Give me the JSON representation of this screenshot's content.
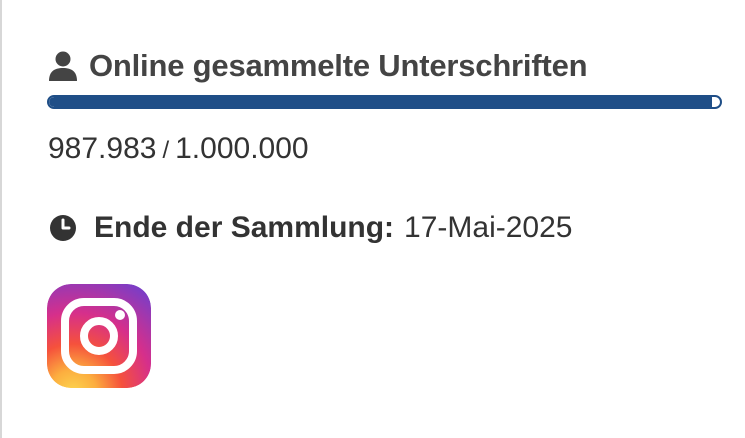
{
  "signatures": {
    "title": "Online gesammelte Unterschriften",
    "collected": "987.983",
    "separator": "/",
    "goal": "1.000.000",
    "progress_fraction": 0.987983
  },
  "collection_end": {
    "label": "Ende der Sammlung:",
    "date": "17-Mai-2025"
  },
  "icons": {
    "person": "person-icon",
    "clock": "clock-icon",
    "social": "instagram-icon"
  },
  "colors": {
    "progress": "#1f4e87",
    "text": "#333333",
    "title": "#444444"
  }
}
